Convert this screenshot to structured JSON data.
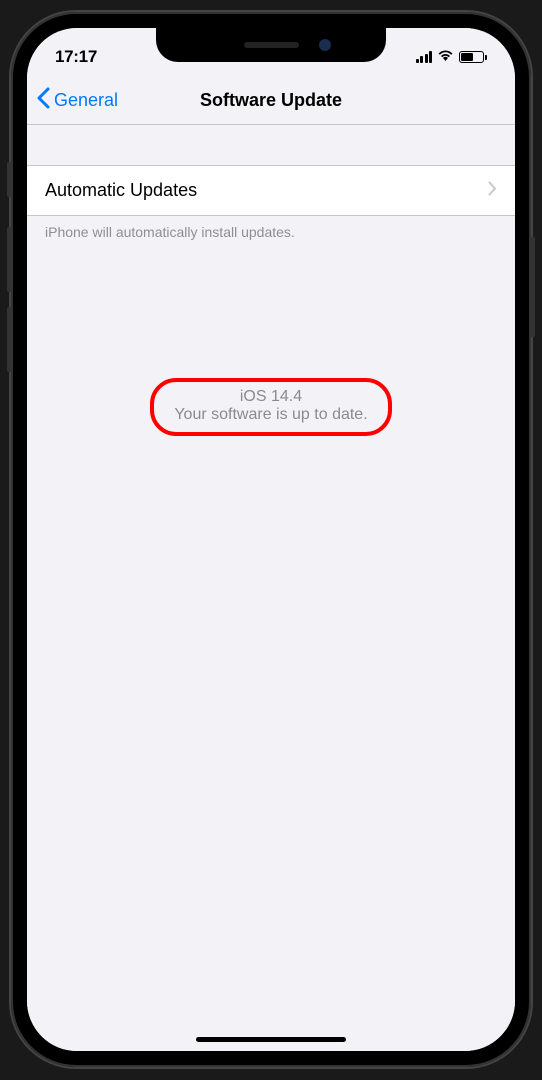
{
  "statusBar": {
    "time": "17:17"
  },
  "nav": {
    "backLabel": "General",
    "title": "Software Update"
  },
  "list": {
    "automaticUpdates": {
      "label": "Automatic Updates"
    },
    "footer": "iPhone will automatically install updates."
  },
  "status": {
    "version": "iOS 14.4",
    "message": "Your software is up to date."
  },
  "annotation": {
    "highlight": "red-circle"
  }
}
